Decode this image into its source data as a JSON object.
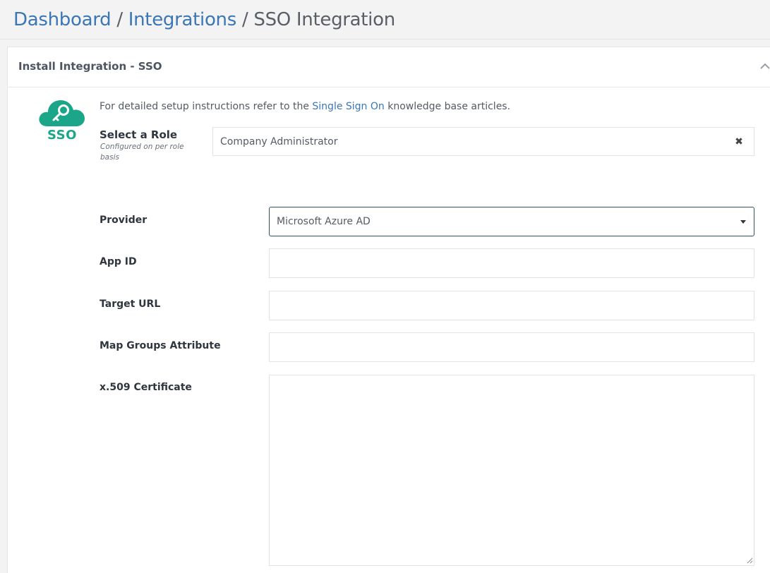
{
  "breadcrumb": {
    "items": [
      {
        "label": "Dashboard"
      },
      {
        "label": "Integrations"
      },
      {
        "label": "SSO Integration"
      }
    ],
    "separator": "/"
  },
  "panel": {
    "title": "Install Integration - SSO"
  },
  "logo": {
    "text": "SSO",
    "icon": "cloud-key-icon",
    "color": "#1ba68a"
  },
  "intro": {
    "prefix": "For detailed setup instructions refer to the",
    "link": "Single Sign On",
    "suffix": "knowledge base articles."
  },
  "role": {
    "label": "Select a Role",
    "hint": "Configured on per role basis",
    "value": "Company Administrator",
    "clear_icon": "close-icon"
  },
  "form": {
    "provider": {
      "label": "Provider",
      "value": "Microsoft Azure AD"
    },
    "app_id": {
      "label": "App ID",
      "value": ""
    },
    "target_url": {
      "label": "Target URL",
      "value": ""
    },
    "map_groups": {
      "label": "Map Groups Attribute",
      "value": ""
    },
    "certificate": {
      "label": "x.509 Certificate",
      "value": ""
    }
  },
  "colors": {
    "link": "#3a77b4",
    "accent": "#1ba68a",
    "focus_border": "#2e5463"
  }
}
